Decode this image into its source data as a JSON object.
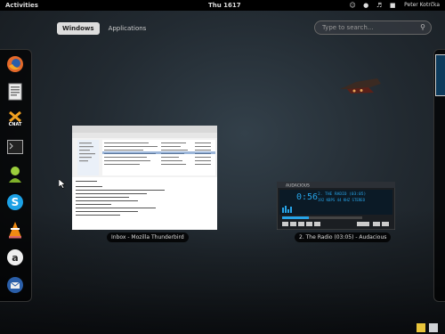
{
  "topbar": {
    "activities": "Activities",
    "clock": "Thu 1617",
    "user": "Peter Kotrčka",
    "icons": [
      "accessibility-icon",
      "wifi-icon",
      "volume-icon",
      "user-icon"
    ]
  },
  "overview": {
    "tabs": [
      "Windows",
      "Applications"
    ],
    "active_tab": "Windows",
    "search_placeholder": "Type to search..."
  },
  "dash": {
    "apps": [
      "firefox-icon",
      "text-editor-icon",
      "cnat-icon",
      "terminal-icon",
      "pidgin-icon",
      "skype-icon",
      "vlc-icon",
      "amazon-icon",
      "thunderbird-icon"
    ],
    "cnat_label": "CNAT"
  },
  "windows": [
    {
      "caption": "Inbox - Mozilla Thunderbird"
    },
    {
      "caption": "2. The Radio (03:05) - Audacious"
    }
  ],
  "audacious": {
    "title": "AUDACIOUS",
    "time": "0:56",
    "track": "2. THE RADIO  (03:05)",
    "info": "192 KBPS  44 KHZ  STEREO"
  },
  "colors": {
    "accent": "#4aa3df",
    "audacious_lcd": "#27a4e8"
  }
}
